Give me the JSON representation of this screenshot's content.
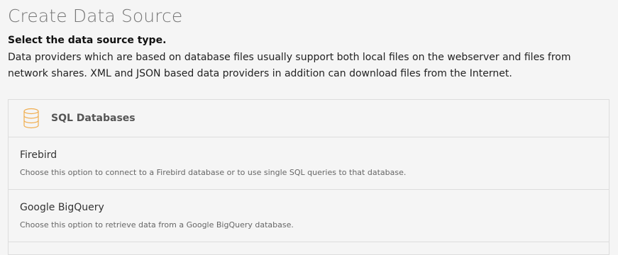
{
  "page": {
    "title": "Create Data Source",
    "subtitle": "Select the data source type.",
    "description": "Data providers which are based on database files usually support both local files on the webserver and files from network shares. XML and JSON based data providers in addition can download files from the Internet."
  },
  "panel": {
    "header_label": "SQL Databases",
    "header_icon": "database-icon",
    "accent_color": "#f0ad4e",
    "options": [
      {
        "title": "Firebird",
        "description": "Choose this option to connect to a Firebird database or to use single SQL queries to that database."
      },
      {
        "title": "Google BigQuery",
        "description": "Choose this option to retrieve data from a Google BigQuery database."
      }
    ]
  }
}
